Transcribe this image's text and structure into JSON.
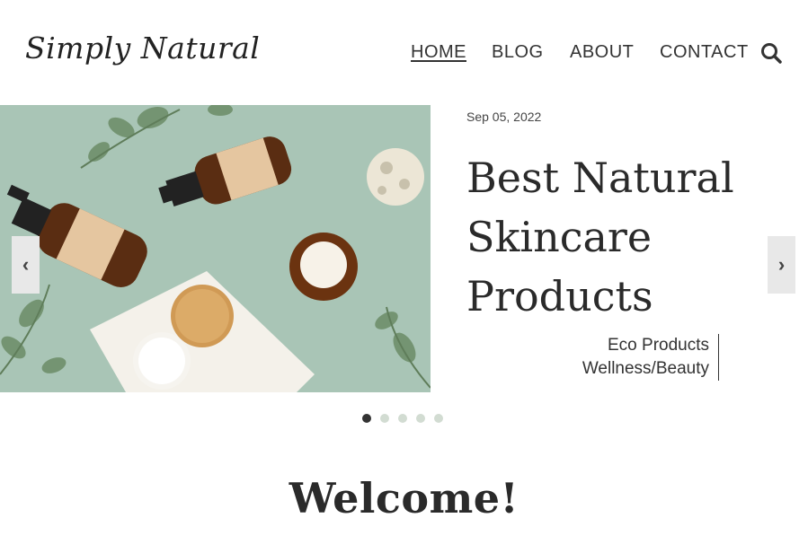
{
  "site": {
    "logo": "Simply Natural"
  },
  "nav": {
    "items": [
      {
        "label": "HOME",
        "active": true
      },
      {
        "label": "BLOG",
        "active": false
      },
      {
        "label": "ABOUT",
        "active": false
      },
      {
        "label": "CONTACT",
        "active": false
      }
    ],
    "search_icon": "search-icon"
  },
  "slider": {
    "image_alt": "skincare-products-flatlay",
    "post": {
      "date": "Sep 05, 2022",
      "title": "Best Natural Skincare Products",
      "categories": [
        "Eco Products",
        "Wellness/Beauty"
      ]
    },
    "prev_label": "‹",
    "next_label": "›",
    "slide_count": 5,
    "active_slide": 1
  },
  "welcome": {
    "heading": "Welcome!"
  },
  "colors": {
    "background": "#ffffff",
    "text": "#333333",
    "image_bg": "#a8c4b4",
    "dot_inactive": "#d2dcd2"
  }
}
